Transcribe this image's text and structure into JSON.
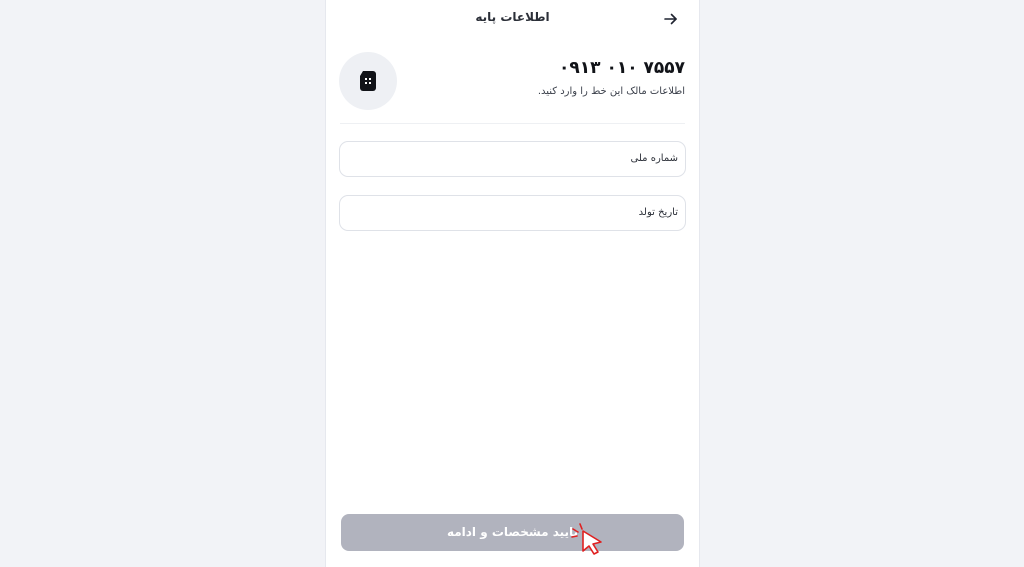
{
  "header": {
    "title": "اطلاعات پایه",
    "back_icon": "arrow-right-icon"
  },
  "line": {
    "number": "۰۹۱۳ ۰۱۰ ۷۵۵۷",
    "subtitle": "اطلاعات مالک این خط را وارد کنید.",
    "icon": "sim-card-icon"
  },
  "form": {
    "national_id_label": "شماره ملی",
    "birth_date_label": "تاریخ تولد"
  },
  "submit": {
    "label": "تایید مشخصات و ادامه",
    "color": "#b1b3be"
  },
  "colors": {
    "background": "#f2f3f7",
    "panel": "#ffffff",
    "cursor": "#e02020"
  }
}
